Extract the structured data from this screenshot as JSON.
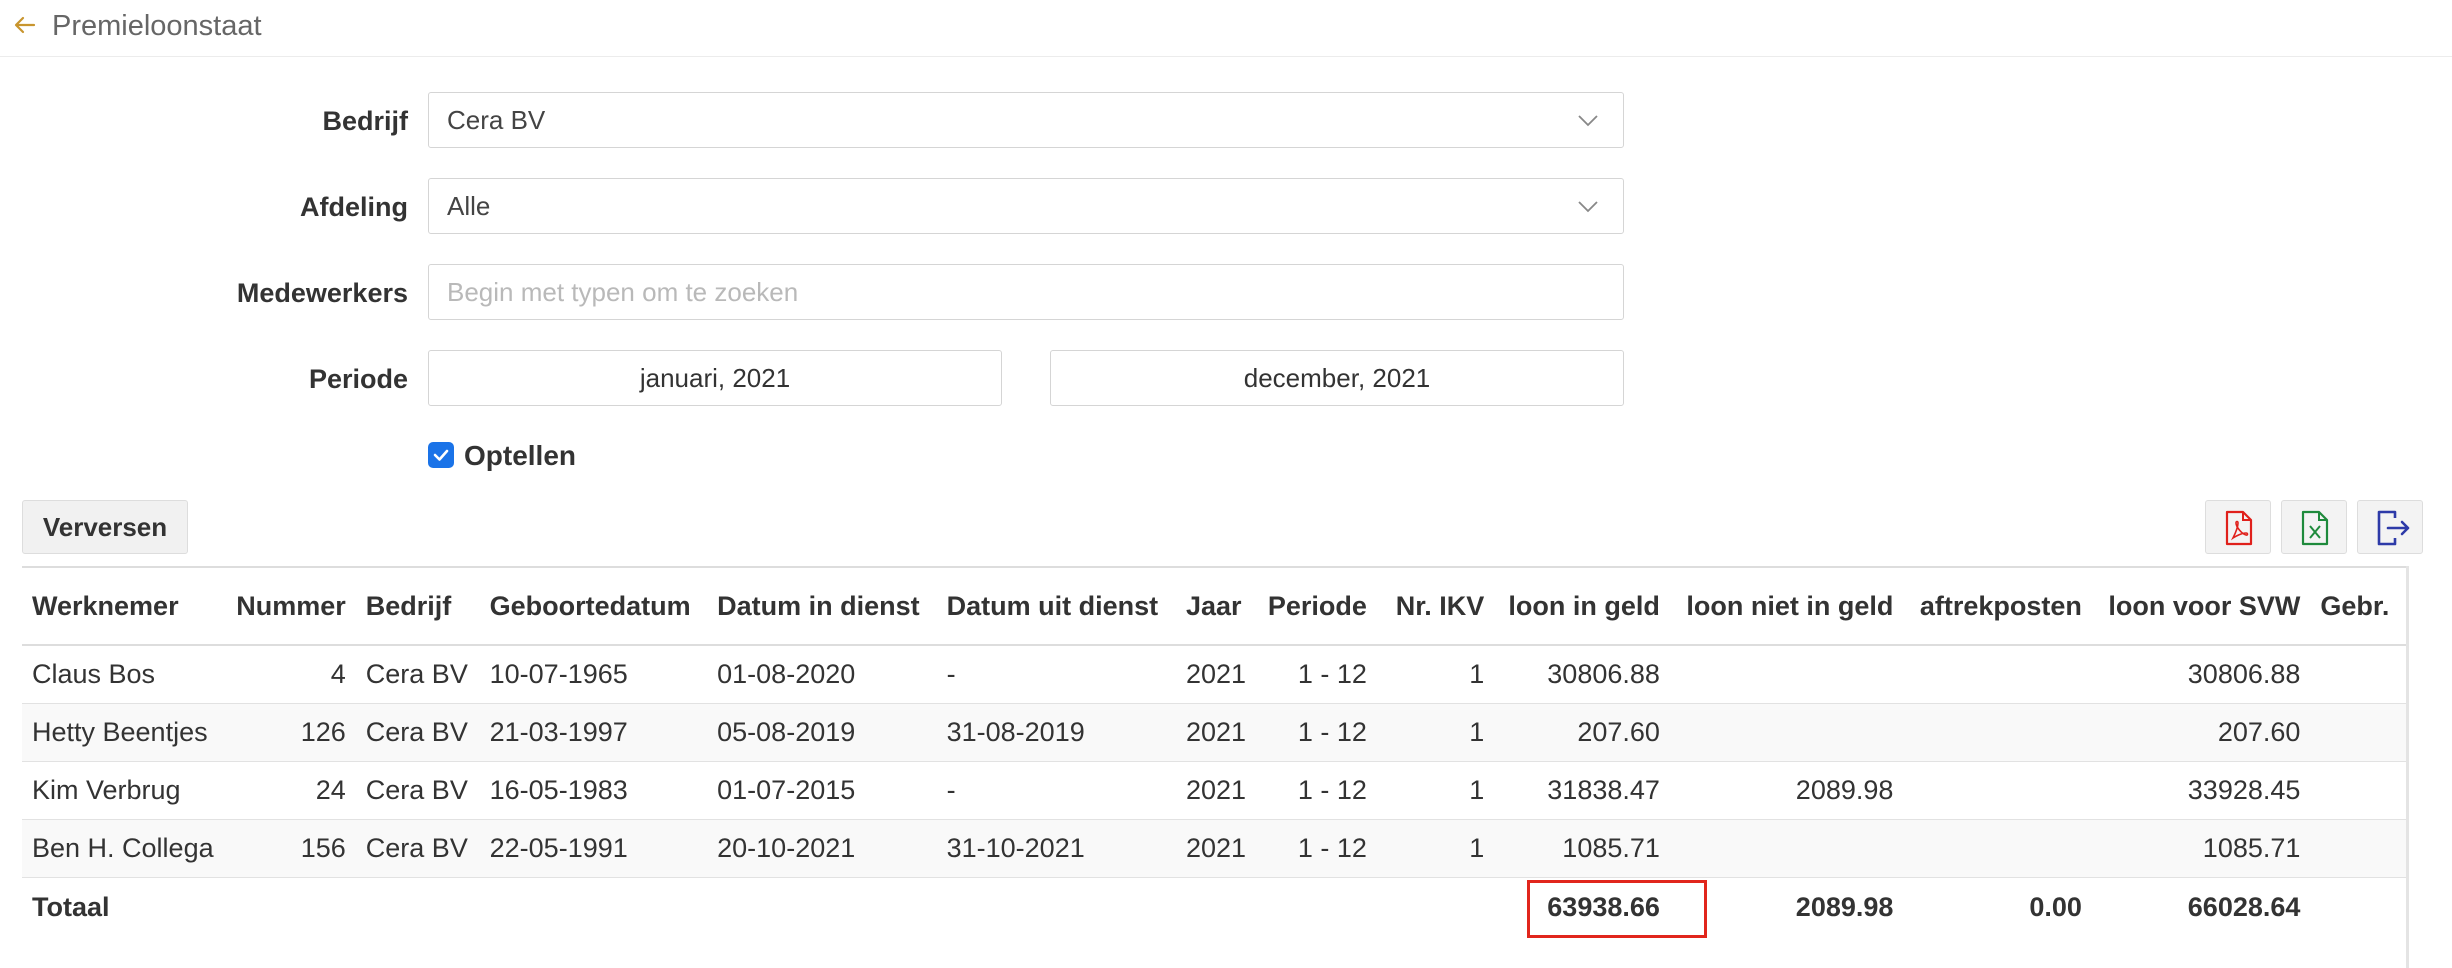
{
  "header": {
    "title": "Premieloonstaat",
    "back_icon": "arrow-left-icon"
  },
  "form": {
    "bedrijf_label": "Bedrijf",
    "bedrijf_value": "Cera BV",
    "afdeling_label": "Afdeling",
    "afdeling_value": "Alle",
    "medewerkers_label": "Medewerkers",
    "medewerkers_placeholder": "Begin met typen om te zoeken",
    "periode_label": "Periode",
    "periode_from": "januari, 2021",
    "periode_to": "december, 2021",
    "optellen_label": "Optellen",
    "optellen_checked": true
  },
  "toolbar": {
    "refresh_label": "Verversen",
    "export_pdf_icon": "pdf-icon",
    "export_excel_icon": "excel-icon",
    "export_icon": "export-icon"
  },
  "colors": {
    "accent": "#c8952e",
    "checkbox": "#1a73e8",
    "pdf": "#e0201b",
    "excel": "#1e8a3c",
    "export": "#2d3aa8",
    "highlight": "#e1261c"
  },
  "table": {
    "headers": [
      "Werknemer",
      "Nummer",
      "Bedrijf",
      "Geboortedatum",
      "Datum in dienst",
      "Datum uit dienst",
      "Jaar",
      "Periode",
      "Nr. IKV",
      "loon in geld",
      "loon niet in geld",
      "aftrekposten",
      "loon voor SVW",
      "Gebr."
    ],
    "rows": [
      [
        "Claus Bos",
        "4",
        "Cera BV",
        "10-07-1965",
        "01-08-2020",
        "-",
        "2021",
        "1 - 12",
        "1",
        "30806.88",
        "",
        "",
        "30806.88",
        ""
      ],
      [
        "Hetty Beentjes",
        "126",
        "Cera BV",
        "21-03-1997",
        "05-08-2019",
        "31-08-2019",
        "2021",
        "1 - 12",
        "1",
        "207.60",
        "",
        "",
        "207.60",
        ""
      ],
      [
        "Kim Verbrug",
        "24",
        "Cera BV",
        "16-05-1983",
        "01-07-2015",
        "-",
        "2021",
        "1 - 12",
        "1",
        "31838.47",
        "2089.98",
        "",
        "33928.45",
        ""
      ],
      [
        "Ben H. Collega",
        "156",
        "Cera BV",
        "22-05-1991",
        "20-10-2021",
        "31-10-2021",
        "2021",
        "1 - 12",
        "1",
        "1085.71",
        "",
        "",
        "1085.71",
        ""
      ]
    ],
    "totals": {
      "label": "Totaal",
      "loon_in_geld": "63938.66",
      "loon_niet_in_geld": "2089.98",
      "aftrekposten": "0.00",
      "loon_voor_svw": "66028.64"
    }
  }
}
